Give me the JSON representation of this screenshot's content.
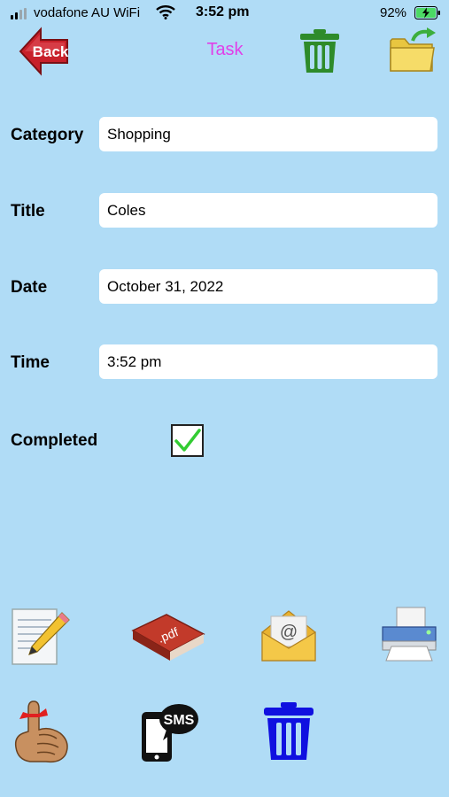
{
  "status_bar": {
    "carrier": "vodafone AU WiFi",
    "time": "3:52 pm",
    "battery_percent": "92%",
    "battery_level": 0.92,
    "signal_icon": "cell-signal-icon",
    "wifi_icon": "wifi-icon",
    "battery_icon": "battery-charging-icon"
  },
  "toolbar": {
    "back_label": "Back",
    "title": "Task",
    "delete_icon": "trash-icon",
    "open_icon": "folder-open-icon"
  },
  "form": {
    "category": {
      "label": "Category",
      "value": "Shopping"
    },
    "title": {
      "label": "Title",
      "value": "Coles"
    },
    "date": {
      "label": "Date",
      "value": "October 31, 2022"
    },
    "time": {
      "label": "Time",
      "value": "3:52 pm"
    },
    "completed": {
      "label": "Completed",
      "checked": true
    }
  },
  "actions": {
    "row1": [
      "notepad-pencil-icon",
      "pdf-book-icon",
      "email-envelope-icon",
      "printer-icon"
    ],
    "row2": [
      "reminder-finger-icon",
      "sms-phone-icon",
      "trash-icon"
    ]
  },
  "colors": {
    "background": "#b0dcf6",
    "title": "#e040e8",
    "back_button": "#c8202a",
    "trash_top": "#2e8b2a",
    "trash_bottom": "#1010e0",
    "checkmark": "#33cc33"
  }
}
